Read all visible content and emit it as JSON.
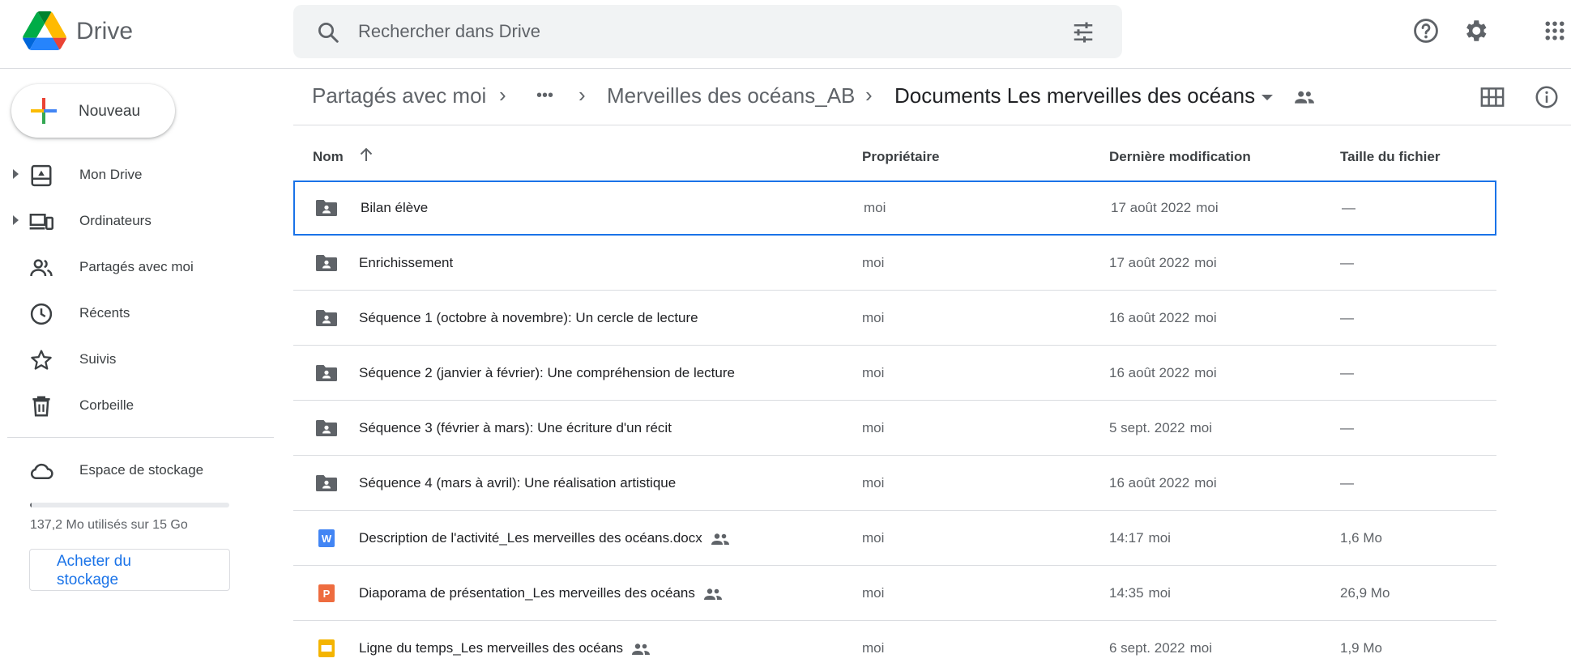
{
  "app": {
    "name": "Drive"
  },
  "search": {
    "placeholder": "Rechercher dans Drive"
  },
  "sidebar": {
    "new_label": "Nouveau",
    "items": [
      {
        "label": "Mon Drive",
        "icon": "my-drive-icon",
        "expandable": true
      },
      {
        "label": "Ordinateurs",
        "icon": "computers-icon",
        "expandable": true
      },
      {
        "label": "Partagés avec moi",
        "icon": "shared-people-icon",
        "expandable": false
      },
      {
        "label": "Récents",
        "icon": "clock-icon",
        "expandable": false
      },
      {
        "label": "Suivis",
        "icon": "star-icon",
        "expandable": false
      },
      {
        "label": "Corbeille",
        "icon": "trash-icon",
        "expandable": false
      }
    ],
    "storage": {
      "label": "Espace de stockage",
      "usage_text": "137,2 Mo utilisés sur 15 Go",
      "used_fraction": 0.009,
      "buy_label": "Acheter du stockage"
    }
  },
  "breadcrumb": {
    "root": "Partagés avec moi",
    "ellipsis": "•••",
    "parent": "Merveilles des océans_AB",
    "current": "Documents Les merveilles des océans"
  },
  "columns": {
    "name": "Nom",
    "owner": "Propriétaire",
    "modified": "Dernière modification",
    "size": "Taille du fichier"
  },
  "files": [
    {
      "name": "Bilan élève",
      "type": "shared-folder",
      "owner": "moi",
      "modified": "17 août 2022",
      "modified_by": "moi",
      "size": "—",
      "shared": false,
      "selected": true
    },
    {
      "name": "Enrichissement",
      "type": "shared-folder",
      "owner": "moi",
      "modified": "17 août 2022",
      "modified_by": "moi",
      "size": "—",
      "shared": false,
      "selected": false
    },
    {
      "name": "Séquence 1 (octobre à novembre): Un cercle de lecture",
      "type": "shared-folder",
      "owner": "moi",
      "modified": "16 août 2022",
      "modified_by": "moi",
      "size": "—",
      "shared": false,
      "selected": false
    },
    {
      "name": "Séquence 2 (janvier à février): Une compréhension de lecture",
      "type": "shared-folder",
      "owner": "moi",
      "modified": "16 août 2022",
      "modified_by": "moi",
      "size": "—",
      "shared": false,
      "selected": false
    },
    {
      "name": "Séquence 3 (février à mars): Une écriture d'un récit",
      "type": "shared-folder",
      "owner": "moi",
      "modified": "5 sept. 2022",
      "modified_by": "moi",
      "size": "—",
      "shared": false,
      "selected": false
    },
    {
      "name": "Séquence 4 (mars à avril): Une réalisation artistique",
      "type": "shared-folder",
      "owner": "moi",
      "modified": "16 août 2022",
      "modified_by": "moi",
      "size": "—",
      "shared": false,
      "selected": false
    },
    {
      "name": "Description de l'activité_Les merveilles des océans.docx",
      "type": "word",
      "type_letter": "W",
      "owner": "moi",
      "modified": "14:17",
      "modified_by": "moi",
      "size": "1,6 Mo",
      "shared": true,
      "selected": false
    },
    {
      "name": "Diaporama de présentation_Les merveilles des océans",
      "type": "powerpoint",
      "type_letter": "P",
      "owner": "moi",
      "modified": "14:35",
      "modified_by": "moi",
      "size": "26,9 Mo",
      "shared": true,
      "selected": false
    },
    {
      "name": "Ligne du temps_Les merveilles des océans",
      "type": "slides",
      "owner": "moi",
      "modified": "6 sept. 2022",
      "modified_by": "moi",
      "size": "1,9 Mo",
      "shared": true,
      "selected": false
    }
  ],
  "colors": {
    "accent": "#1a73e8",
    "word": "#4285f4",
    "powerpoint": "#ee6c3f",
    "slides": "#f4b400",
    "folder": "#5f6368"
  }
}
